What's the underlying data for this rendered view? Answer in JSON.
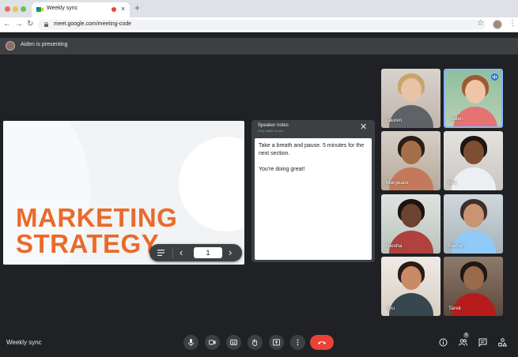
{
  "browser": {
    "tab_title": "Weekly sync",
    "url": "meet.google.com/meeting-code",
    "traffic_lights": [
      "#ee6a5f",
      "#f5bd4f",
      "#61c454"
    ]
  },
  "meet": {
    "presenting_text": "Aiden is presenting",
    "meeting_name": "Weekly sync",
    "participant_count": "6",
    "slide": {
      "title": "MARKETING\nSTRATEGY",
      "accent_color": "#ea6a2a",
      "page": "1"
    },
    "speaker_notes": {
      "title": "Speaker notes",
      "subtitle": "Only visible to you",
      "lines": [
        "Take a breath and pause. 5 minutes for the next section.",
        "You're doing great!"
      ]
    },
    "participants": [
      {
        "name": "Lauren",
        "active": false
      },
      {
        "name": "Aiden",
        "active": true
      },
      {
        "name": "Margeaux",
        "active": false
      },
      {
        "name": "Mia",
        "active": false
      },
      {
        "name": "Niesha",
        "active": false
      },
      {
        "name": "Nathan",
        "active": false
      },
      {
        "name": "You",
        "active": false
      },
      {
        "name": "Tarek",
        "active": false
      }
    ],
    "controls": [
      "mic-icon",
      "camera-icon",
      "captions-icon",
      "raise-hand-icon",
      "present-icon",
      "more-options-icon",
      "hang-up-icon"
    ],
    "side_controls": [
      "info-icon",
      "people-icon",
      "chat-icon",
      "activities-icon"
    ],
    "hangup_color": "#ea4335",
    "active_border_color": "#8ab4f8"
  }
}
